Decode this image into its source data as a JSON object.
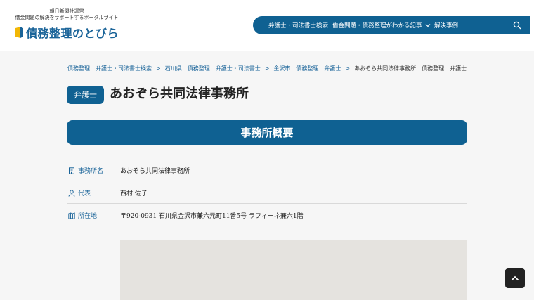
{
  "header": {
    "logo_sub1": "朝日新聞社運営",
    "logo_sub2": "借金問題の解決をサポートするポータルサイト",
    "logo_text": "債務整理のとびら",
    "brand_color": "#0f6192",
    "nav": {
      "item1": "弁護士・司法書士検索",
      "item2": "借金問題・債務整理がわかる記事",
      "item3": "解決事例",
      "search_icon": "search-icon",
      "chevron_icon": "chevron-down-icon"
    }
  },
  "breadcrumb": {
    "items": [
      "債務整理",
      "弁護士・司法書士検索",
      "石川県",
      "債務整理",
      "弁護士・司法書士",
      "金沢市",
      "債務整理",
      "弁護士"
    ],
    "current": "あおぞら共同法律事務所",
    "tags": [
      "債務整理",
      "弁護士"
    ]
  },
  "title": {
    "badge": "弁護士",
    "name": "あおぞら共同法律事務所"
  },
  "section": {
    "heading": "事務所概要"
  },
  "info": {
    "office_label": "事務所名",
    "office_value": "あおぞら共同法律事務所",
    "rep_label": "代表",
    "rep_value": "西村 佐子",
    "address_label": "所在地",
    "address_value": "〒920-0931 石川県金沢市兼六元町11番5号 ラフィーネ兼六1階"
  },
  "icons": {
    "office": "building-icon",
    "rep": "person-icon",
    "address": "map-icon",
    "scroll": "chevron-up-icon"
  }
}
